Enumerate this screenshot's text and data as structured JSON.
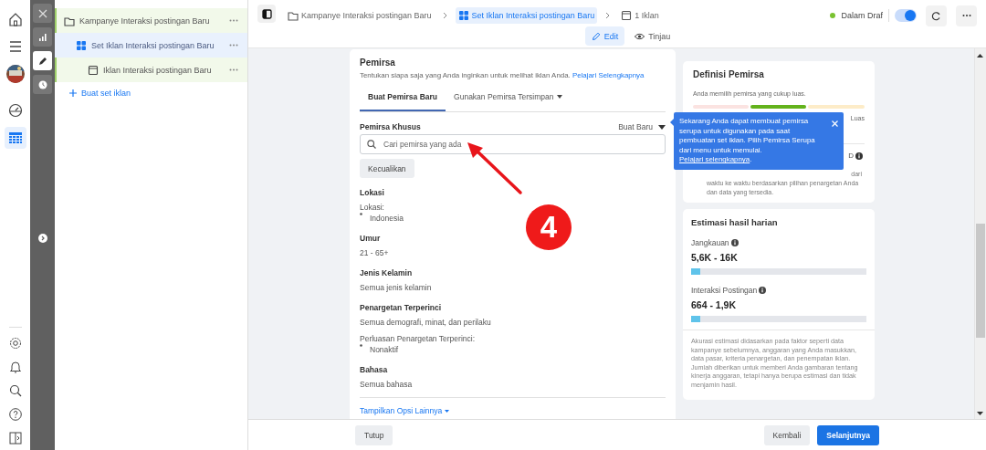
{
  "rail": {
    "nav": [
      {
        "kind": "dashboard",
        "selected": false
      },
      {
        "kind": "table",
        "selected": true
      }
    ]
  },
  "tools": [
    {
      "kind": "chart",
      "selected": false
    },
    {
      "kind": "edit",
      "selected": true
    },
    {
      "kind": "history",
      "selected": false
    }
  ],
  "tree": {
    "items": [
      {
        "label": "Kampanye Interaksi postingan Baru",
        "kind": "campaign",
        "selected": false,
        "children": [
          {
            "label": "Set Iklan Interaksi postingan Baru",
            "kind": "adset",
            "selected": true,
            "children": [
              {
                "label": "Iklan Interaksi postingan Baru",
                "kind": "ad",
                "selected": false
              }
            ]
          }
        ]
      }
    ],
    "create_link": "Buat set iklan"
  },
  "breadcrumb": [
    {
      "label": "Kampanye Interaksi postingan Baru",
      "kind": "campaign",
      "selected": false
    },
    {
      "label": "Set Iklan Interaksi postingan Baru",
      "kind": "adset",
      "selected": true
    },
    {
      "label": "1 Iklan",
      "kind": "ad",
      "selected": false
    }
  ],
  "mode_tabs": [
    {
      "label": "Edit",
      "kind": "edit",
      "selected": true
    },
    {
      "label": "Tinjau",
      "kind": "view",
      "selected": false
    }
  ],
  "status": {
    "label": "Dalam Draf",
    "color": "#7ac231"
  },
  "toggle": {
    "on": true
  },
  "audience": {
    "title": "Pemirsa",
    "description": "Tentukan siapa saja yang Anda inginkan untuk melihat iklan Anda.",
    "link": "Pelajari Selengkapnya",
    "tabs": [
      {
        "label": "Buat Pemirsa Baru",
        "selected": true,
        "dropdown": false
      },
      {
        "label": "Gunakan Pemirsa Tersimpan",
        "selected": false,
        "dropdown": true
      }
    ],
    "custom": {
      "label": "Pemirsa Khusus",
      "menu": "Buat Baru",
      "placeholder": "Cari pemirsa yang ada",
      "exclude": "Kecualikan"
    },
    "sections": [
      {
        "heading": "Lokasi",
        "lines": [
          {
            "kind": "text",
            "text": "Lokasi:"
          },
          {
            "kind": "bullet",
            "text": "Indonesia"
          }
        ]
      },
      {
        "heading": "Umur",
        "lines": [
          {
            "kind": "text",
            "text": "21 - 65+"
          }
        ]
      },
      {
        "heading": "Jenis Kelamin",
        "lines": [
          {
            "kind": "text",
            "text": "Semua jenis kelamin"
          }
        ]
      },
      {
        "heading": "Penargetan Terperinci",
        "lines": [
          {
            "kind": "text",
            "text": "Semua demografi, minat, dan perilaku"
          },
          {
            "kind": "gap"
          },
          {
            "kind": "text",
            "text": "Perluasan Penargetan Terperinci:"
          },
          {
            "kind": "bullet",
            "text": "Nonaktif"
          }
        ]
      },
      {
        "heading": "Bahasa",
        "lines": [
          {
            "kind": "text",
            "text": "Semua bahasa"
          }
        ]
      }
    ],
    "more_link": "Tampilkan Opsi Lainnya"
  },
  "definition": {
    "title": "Definisi Pemirsa",
    "summary": "Anda memilih pemirsa yang cukup luas.",
    "gauge_end": "Luas",
    "fragment": "D",
    "note_lines": [
      "dari",
      "waktu ke waktu berdasarkan pilihan penargetan Anda",
      "dan data yang tersedia."
    ]
  },
  "tooltip": {
    "text": "Sekarang Anda dapat membuat pemirsa serupa untuk digunakan pada saat pembuatan set iklan. Pilih Pemirsa Serupa dari menu untuk memulai. ",
    "link": "Pelajari selengkapnya",
    "tail": "."
  },
  "estimates": {
    "title": "Estimasi hasil harian",
    "metrics": [
      {
        "label": "Jangkauan",
        "value": "5,6K - 16K",
        "level": 0.05
      },
      {
        "label": "Interaksi Postingan",
        "value": "664 - 1,9K",
        "level": 0.05
      }
    ],
    "disclaimer": "Akurasi estimasi didasarkan pada faktor seperti data kampanye sebelumnya, anggaran yang Anda masukkan, data pasar, kriteria penargetan, dan penempatan iklan. Jumlah diberikan untuk memberi Anda gambaran tentang kinerja anggaran, tetapi hanya berupa estimasi dan tidak menjamin hasil."
  },
  "footer": {
    "close": "Tutup",
    "back": "Kembali",
    "next": "Selanjutnya"
  },
  "annotation": {
    "number": "4"
  }
}
